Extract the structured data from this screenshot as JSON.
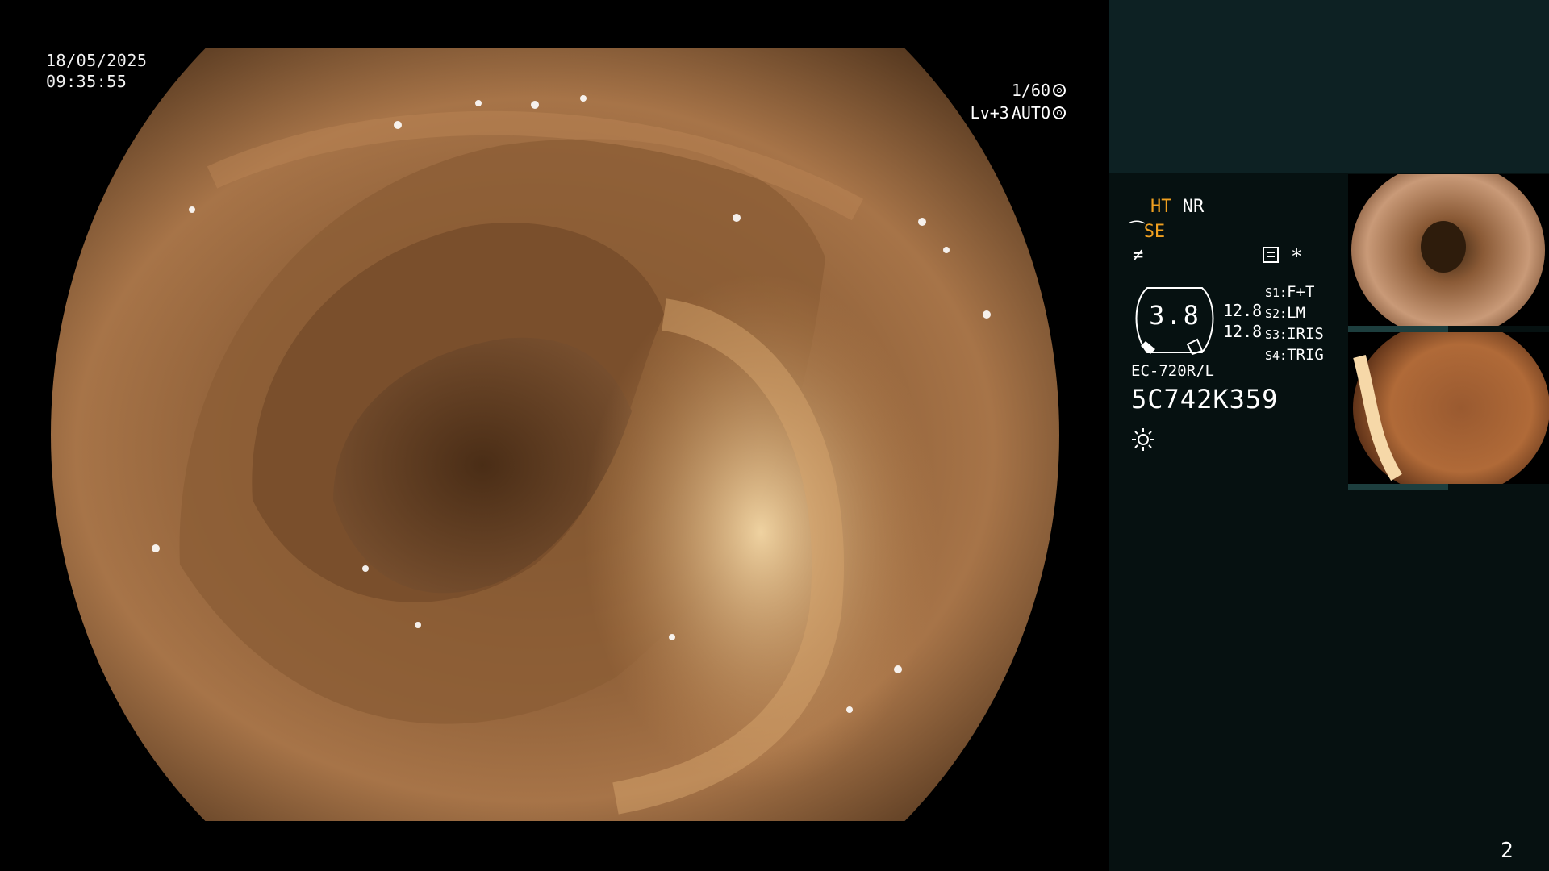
{
  "osd": {
    "date": "18/05/2025",
    "time": "09:35:55",
    "shutter": "1/60",
    "level": "Lv+3",
    "mode": "AUTO"
  },
  "side": {
    "ht": "HT",
    "nr": "NR",
    "se": "SE",
    "freeze_glyph": "≠",
    "asterisk": "*",
    "gauge_value": "3.8",
    "gauge_num1": "12.8",
    "gauge_num2": "12.8",
    "modes": [
      {
        "label": "S1:",
        "value": "F+T"
      },
      {
        "label": "S2:",
        "value": "LM"
      },
      {
        "label": "S3:",
        "value": "IRIS"
      },
      {
        "label": "S4:",
        "value": "TRIG"
      }
    ],
    "model": "EC-720R/L",
    "serial": "5C742K359"
  },
  "page_number": "2",
  "colors": {
    "accent": "#f0a020",
    "panel_header": "#0d2123",
    "panel_body": "#061111"
  }
}
